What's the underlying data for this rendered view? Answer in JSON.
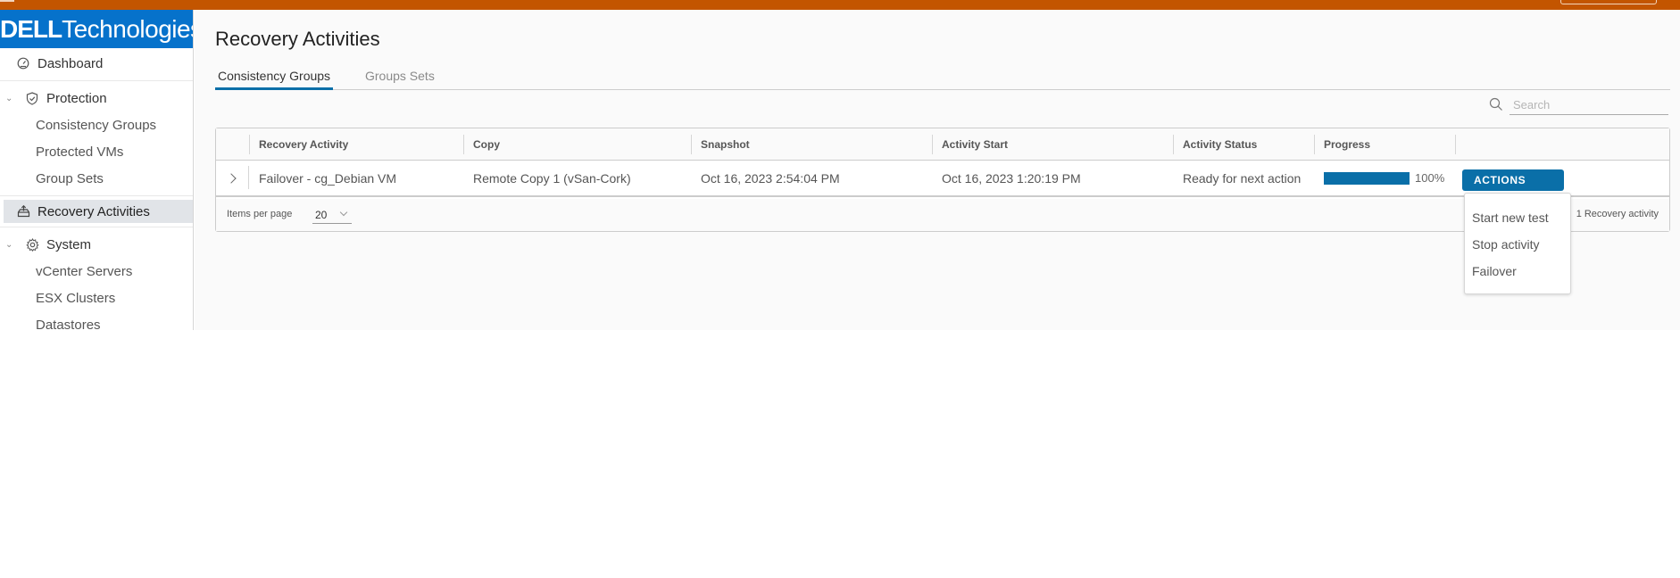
{
  "brand": {
    "dell": "DЄLL",
    "tech": "Technologies",
    "color": "#0672cb"
  },
  "topbar": {
    "color": "#c35500"
  },
  "sidebar": {
    "dashboard": "Dashboard",
    "protection": {
      "label": "Protection",
      "items": [
        "Consistency Groups",
        "Protected VMs",
        "Group Sets"
      ]
    },
    "recovery_activities": "Recovery Activities",
    "system": {
      "label": "System",
      "items": [
        "vCenter Servers",
        "ESX Clusters",
        "Datastores"
      ]
    }
  },
  "main": {
    "title": "Recovery Activities",
    "tabs": [
      {
        "label": "Consistency Groups",
        "active": true
      },
      {
        "label": "Groups Sets",
        "active": false
      }
    ],
    "search": {
      "placeholder": "Search",
      "value": ""
    },
    "table": {
      "columns": [
        "Recovery Activity",
        "Copy",
        "Snapshot",
        "Activity Start",
        "Activity Status",
        "Progress",
        ""
      ],
      "rows": [
        {
          "recovery_activity": "Failover - cg_Debian VM",
          "copy": "Remote Copy 1 (vSan-Cork)",
          "snapshot": "Oct 16, 2023 2:54:04 PM",
          "activity_start": "Oct 16, 2023 1:20:19 PM",
          "activity_status": "Ready for next action",
          "progress_percent": 100,
          "progress_label": "100%",
          "actions_label": "ACTIONS"
        }
      ],
      "footer": {
        "items_per_page_label": "Items per page",
        "items_per_page_value": "20",
        "count_label": "1 Recovery activity"
      }
    },
    "actions_menu": [
      "Start new test",
      "Stop activity",
      "Failover"
    ]
  },
  "accent_color": "#0a6fa8"
}
